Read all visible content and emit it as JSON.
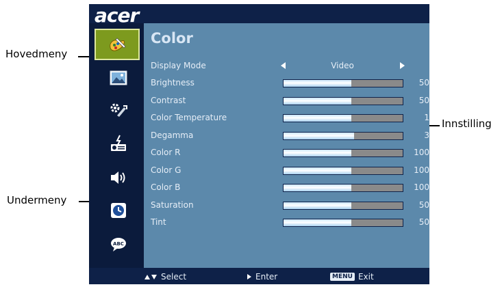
{
  "callouts": {
    "main_menu": "Hovedmeny",
    "sub_menu": "Undermeny",
    "setting": "Innstilling"
  },
  "osd": {
    "brand": "acer",
    "title": "Color",
    "sidebar_icons": [
      "color-icon",
      "image-icon",
      "settings-icon",
      "management-icon",
      "audio-icon",
      "timer-icon",
      "language-icon"
    ],
    "active_index": 0,
    "display_mode": {
      "label": "Display Mode",
      "value": "Video"
    },
    "settings": [
      {
        "label": "Brightness",
        "value": "50",
        "level": 0.57
      },
      {
        "label": "Contrast",
        "value": "50",
        "level": 0.57
      },
      {
        "label": "Color Temperature",
        "value": "1",
        "level": 0.57
      },
      {
        "label": "Degamma",
        "value": "3",
        "level": 0.59
      },
      {
        "label": "Color R",
        "value": "100",
        "level": 0.57
      },
      {
        "label": "Color G",
        "value": "100",
        "level": 0.57
      },
      {
        "label": "Color B",
        "value": "100",
        "level": 0.57
      },
      {
        "label": "Saturation",
        "value": "50",
        "level": 0.57
      },
      {
        "label": "Tint",
        "value": "50",
        "level": 0.57
      }
    ],
    "footer": {
      "select": "Select",
      "enter": "Enter",
      "menu_key": "MENU",
      "exit": "Exit"
    },
    "colors": {
      "frame": "#0e2148",
      "panel": "#5c89ab",
      "active_item": "#7d9a1e"
    }
  }
}
